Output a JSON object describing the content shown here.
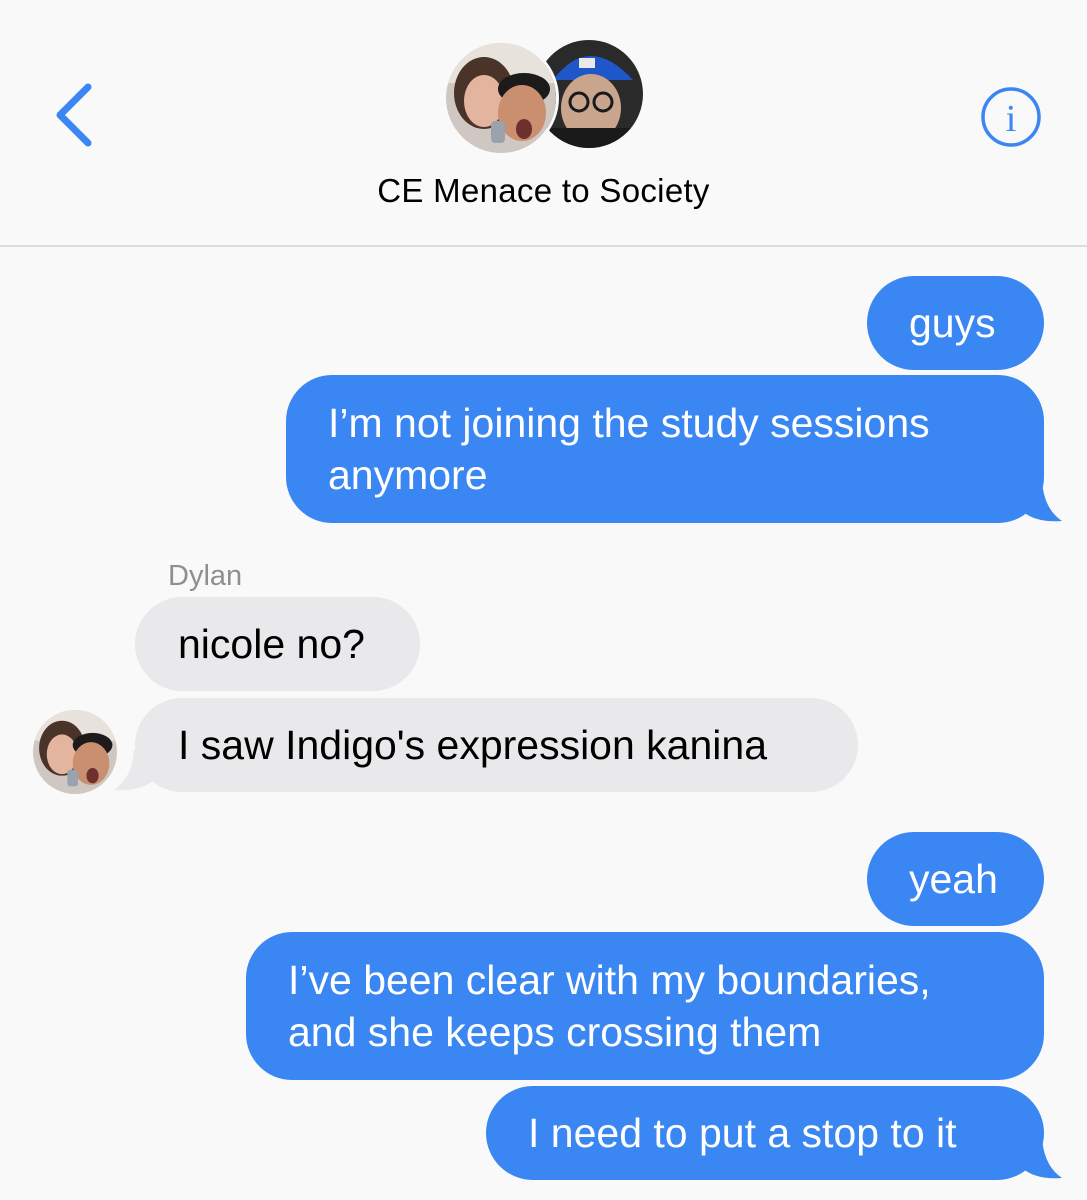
{
  "header": {
    "back_icon": "chevron-left-icon",
    "info_icon": "info-icon",
    "title": "CE Menace to Society",
    "accent_color": "#3a86f2"
  },
  "messages": [
    {
      "direction": "outgoing",
      "text": "guys"
    },
    {
      "direction": "outgoing",
      "lines": [
        "I’m not joining the study sessions",
        "anymore"
      ]
    },
    {
      "direction": "incoming",
      "sender": "Dylan",
      "text": "nicole no?"
    },
    {
      "direction": "incoming",
      "text": "I saw Indigo's expression kanina"
    },
    {
      "direction": "outgoing",
      "text": "yeah"
    },
    {
      "direction": "outgoing",
      "lines": [
        "I’ve been clear with my boundaries,",
        "and she keeps crossing them"
      ]
    },
    {
      "direction": "outgoing",
      "text": "I need to put a stop to it"
    }
  ],
  "colors": {
    "outgoing_bubble": "#3a86f2",
    "incoming_bubble": "#e9e9eb",
    "background": "#f9f9f9"
  }
}
